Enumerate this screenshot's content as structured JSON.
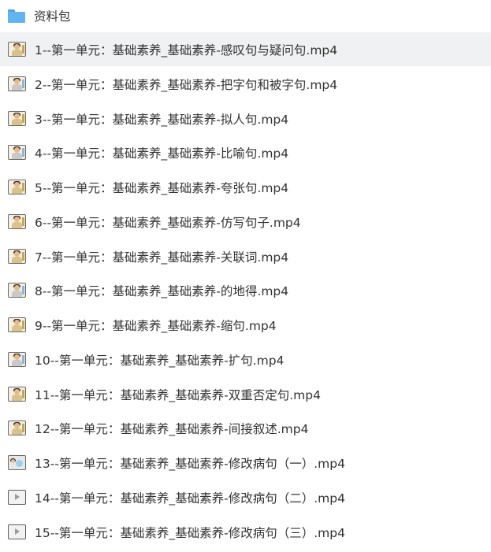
{
  "folder": {
    "name": "资料包",
    "icon": "folder-icon"
  },
  "files": [
    {
      "name": "1--第一单元：基础素养_基础素养-感叹句与疑问句.mp4",
      "icon": "video-thumbnail-icon"
    },
    {
      "name": "2--第一单元：基础素养_基础素养-把字句和被字句.mp4",
      "icon": "video-thumbnail-icon"
    },
    {
      "name": "3--第一单元：基础素养_基础素养-拟人句.mp4",
      "icon": "video-thumbnail-icon"
    },
    {
      "name": "4--第一单元：基础素养_基础素养-比喻句.mp4",
      "icon": "video-thumbnail-icon"
    },
    {
      "name": "5--第一单元：基础素养_基础素养-夸张句.mp4",
      "icon": "video-thumbnail-icon"
    },
    {
      "name": "6--第一单元：基础素养_基础素养-仿写句子.mp4",
      "icon": "video-thumbnail-icon"
    },
    {
      "name": "7--第一单元：基础素养_基础素养-关联词.mp4",
      "icon": "video-thumbnail-icon"
    },
    {
      "name": "8--第一单元：基础素养_基础素养-的地得.mp4",
      "icon": "video-thumbnail-icon"
    },
    {
      "name": "9--第一单元：基础素养_基础素养-缩句.mp4",
      "icon": "video-thumbnail-icon"
    },
    {
      "name": "10--第一单元：基础素养_基础素养-扩句.mp4",
      "icon": "video-thumbnail-icon"
    },
    {
      "name": "11--第一单元：基础素养_基础素养-双重否定句.mp4",
      "icon": "video-thumbnail-icon"
    },
    {
      "name": "12--第一单元：基础素养_基础素养-间接叙述.mp4",
      "icon": "video-thumbnail-icon"
    },
    {
      "name": "13--第一单元：基础素养_基础素养-修改病句（一）.mp4",
      "icon": "video-thumbnail-icon"
    },
    {
      "name": "14--第一单元：基础素养_基础素养-修改病句（二）.mp4",
      "icon": "video-thumbnail-icon"
    },
    {
      "name": "15--第一单元：基础素养_基础素养-修改病句（三）.mp4",
      "icon": "video-thumbnail-icon"
    }
  ],
  "colors": {
    "selected_row_bg": "#eff1f3",
    "folder_blue": "#62b4f0",
    "text": "#333333"
  }
}
